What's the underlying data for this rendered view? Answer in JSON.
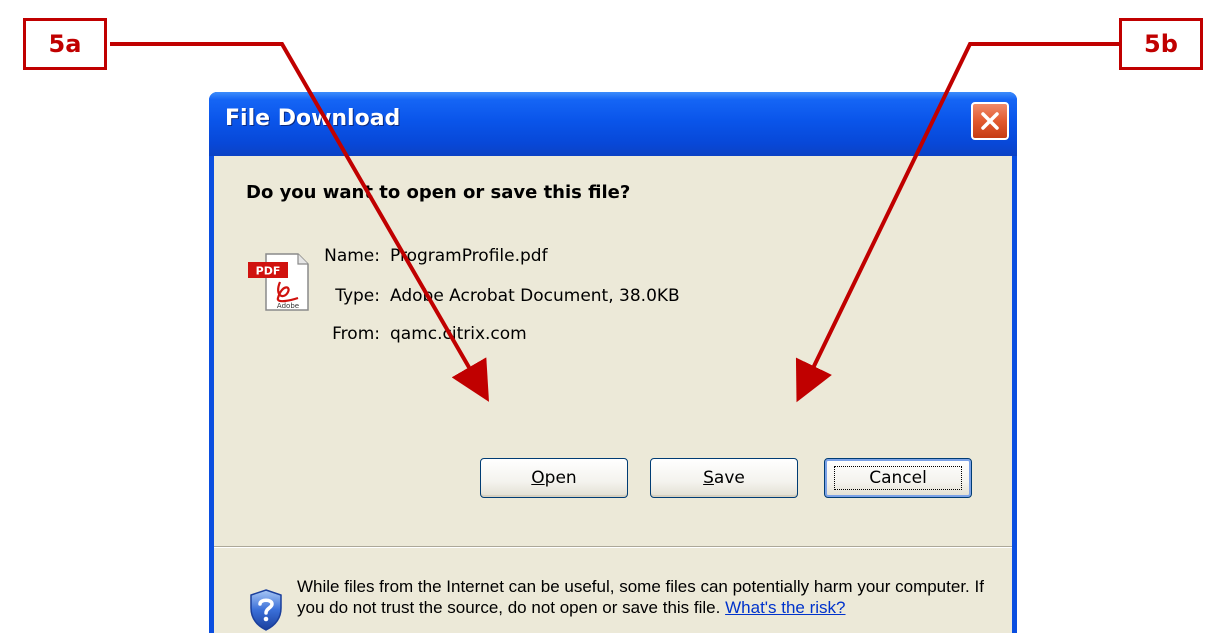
{
  "callouts": {
    "a": "5a",
    "b": "5b"
  },
  "window": {
    "title": "File Download",
    "close_icon": "close-icon"
  },
  "dialog": {
    "question": "Do you want to open or save this file?",
    "file_icon": "pdf-file-icon",
    "file_icon_badge": "PDF",
    "file_icon_caption": "Adobe",
    "name_label": "Name:",
    "name_value": "ProgramProfile.pdf",
    "type_label": "Type:",
    "type_value": "Adobe Acrobat Document, 38.0KB",
    "from_label": "From:",
    "from_value": "qamc.citrix.com"
  },
  "buttons": {
    "open": {
      "mnemonic": "O",
      "rest": "pen"
    },
    "save": {
      "mnemonic": "S",
      "rest": "ave"
    },
    "cancel": "Cancel"
  },
  "warning": {
    "icon": "security-shield-icon",
    "text": "While files from the Internet can be useful, some files can potentially harm your computer. If you do not trust the source, do not open or save this file.",
    "link": "What's the risk?"
  },
  "colors": {
    "callout": "#c00000",
    "titlebar": "#0a55ea",
    "client_bg": "#ece9d8",
    "link": "#0033cc"
  }
}
